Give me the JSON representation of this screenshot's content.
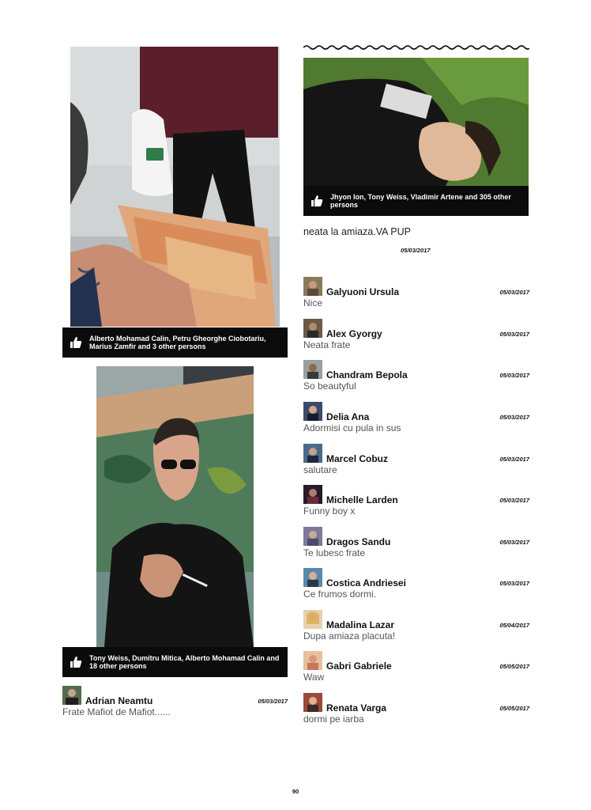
{
  "photos": [
    {
      "likes": "Alberto Mohamad Calin, Petru Gheorghe Ciobotariu, Marius Zamfir and 3 other persons"
    },
    {
      "likes": "Tony Weiss, Dumitru Mitica, Alberto Mohamad Calin and 18 other persons"
    },
    {
      "likes": "Jhyon Ion, Tony Weiss, Vladimir Artene and 305 other persons"
    }
  ],
  "left_comment": {
    "name": "Adrian Neamtu",
    "date": "05/03/2017",
    "text": "Frate Mafiot de Mafiot......"
  },
  "post": {
    "caption": "neata la amiaza.VA PUP",
    "date": "05/03/2017"
  },
  "comments": [
    {
      "name": "Galyuoni Ursula",
      "date": "05/03/2017",
      "text": "Nice"
    },
    {
      "name": "Alex Gyorgy",
      "date": "05/03/2017",
      "text": "Neata frate"
    },
    {
      "name": "Chandram Bepola",
      "date": "05/03/2017",
      "text": "So beautyful"
    },
    {
      "name": "Delia Ana",
      "date": "05/03/2017",
      "text": "Adormisi cu pula in sus"
    },
    {
      "name": "Marcel Cobuz",
      "date": "05/03/2017",
      "text": "salutare"
    },
    {
      "name": "Michelle Larden",
      "date": "05/03/2017",
      "text": "Funny boy x"
    },
    {
      "name": "Dragos Sandu",
      "date": "05/03/2017",
      "text": "Te lubesc frate"
    },
    {
      "name": "Costica Andriesei",
      "date": "05/03/2017",
      "text": "Ce frumos dormi."
    },
    {
      "name": "Madalina Lazar",
      "date": "05/04/2017",
      "text": "Dupa amiaza placuta!"
    },
    {
      "name": "Gabri Gabriele",
      "date": "05/05/2017",
      "text": "Waw"
    },
    {
      "name": "Renata Varga",
      "date": "05/05/2017",
      "text": "dormi pe iarba"
    }
  ],
  "page_number": "90"
}
